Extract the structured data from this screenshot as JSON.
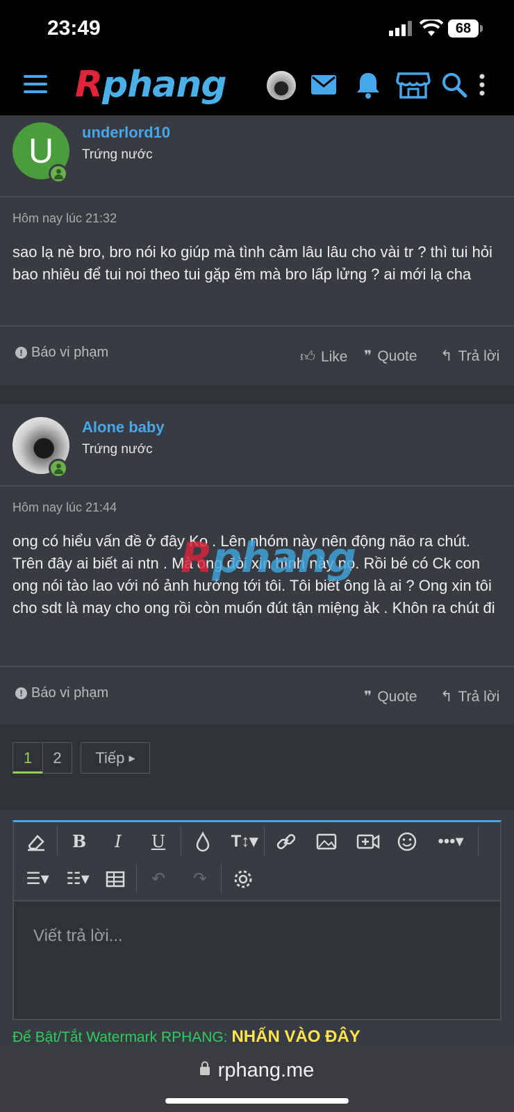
{
  "status_bar": {
    "time": "23:49",
    "battery": "68"
  },
  "header": {
    "logo_first": "R",
    "logo_rest": "phang",
    "icons": [
      "menu-icon",
      "avatar",
      "mail-icon",
      "bell-icon",
      "store-icon",
      "search-icon",
      "more-vertical-icon"
    ]
  },
  "posts": [
    {
      "avatar_letter": "U",
      "username": "underlord10",
      "user_title": "Trứng nước",
      "date": "Hôm nay lúc 21:32",
      "content": "sao lạ nè bro, bro nói ko giúp mà tình cảm lâu lâu cho vài tr ? thì tui hỏi bao nhiêu để tui noi theo tui gặp ẽm mà bro lấp lửng ? ai mới lạ cha",
      "report": "Báo vi phạm",
      "like": "Like",
      "quote": "Quote",
      "reply": "Trả lời"
    },
    {
      "username": "Alone baby",
      "user_title": "Trứng nước",
      "date": "Hôm nay lúc 21:44",
      "content": "ong có hiểu vấn đề ở đây Ko . Lên nhóm này nên động não ra chút. Trên đây ai biết ai ntn . Mà ong đòi xin hình này nọ. Rồi bé có Ck con ong nói tào lao với nó ảnh hưởng tới tôi. Tôi biết ông là ai ? Ong xin tôi cho sdt là may cho ong rồi còn muốn đút tận miệng àk . Khôn ra chút đi",
      "report": "Báo vi phạm",
      "quote": "Quote",
      "reply": "Trả lời"
    }
  ],
  "pagination": {
    "pages": [
      "1",
      "2"
    ],
    "current": "1",
    "next_label": "Tiếp"
  },
  "editor": {
    "placeholder": "Viết trả lời..."
  },
  "watermark_note": {
    "text": "Để Bật/Tắt Watermark RPHANG: ",
    "link": "NHẤN VÀO ĐÂY"
  },
  "browser": {
    "url": "rphang.me"
  },
  "colors": {
    "accent": "#47a7eb",
    "online": "#6ab04c",
    "link_highlight": "#ffe44d",
    "note_green": "#2ecc5e"
  }
}
